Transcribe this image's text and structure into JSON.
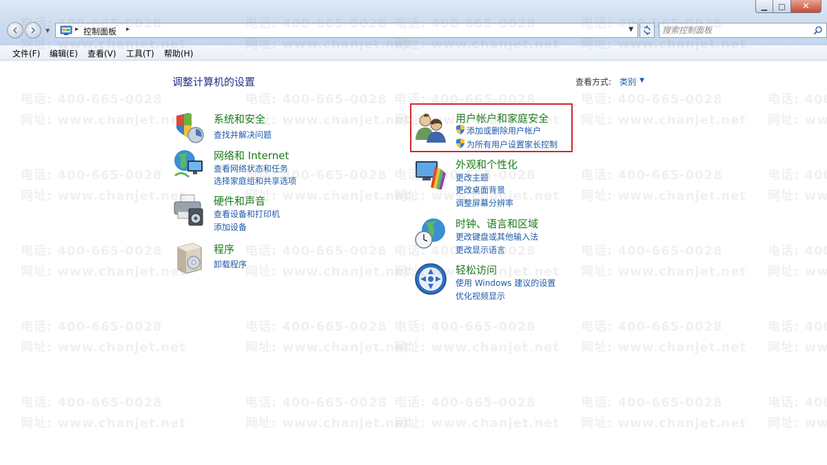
{
  "window": {
    "minimize": "▁",
    "maximize": "□",
    "close": "✕"
  },
  "address": {
    "path": "控制面板"
  },
  "search": {
    "placeholder": "搜索控制面板"
  },
  "menu": {
    "file": "文件(F)",
    "edit": "编辑(E)",
    "view": "查看(V)",
    "tools": "工具(T)",
    "help": "帮助(H)"
  },
  "main": {
    "title": "调整计算机的设置",
    "view_by_label": "查看方式:",
    "view_by_value": "类别"
  },
  "categories": {
    "system": {
      "title": "系统和安全",
      "links": [
        "查找并解决问题"
      ]
    },
    "network": {
      "title": "网络和 Internet",
      "links": [
        "查看网络状态和任务",
        "选择家庭组和共享选项"
      ]
    },
    "hardware": {
      "title": "硬件和声音",
      "links": [
        "查看设备和打印机",
        "添加设备"
      ]
    },
    "programs": {
      "title": "程序",
      "links": [
        "卸载程序"
      ]
    },
    "users": {
      "title": "用户帐户和家庭安全",
      "links": [
        "添加或删除用户帐户",
        "为所有用户设置家长控制"
      ]
    },
    "appearance": {
      "title": "外观和个性化",
      "links": [
        "更改主题",
        "更改桌面背景",
        "调整屏幕分辨率"
      ]
    },
    "clock": {
      "title": "时钟、语言和区域",
      "links": [
        "更改键盘或其他输入法",
        "更改显示语言"
      ]
    },
    "ease": {
      "title": "轻松访问",
      "links": [
        "使用 Windows 建议的设置",
        "优化视频显示"
      ]
    }
  },
  "watermark": {
    "phone": "电话: 400-665-0028",
    "site": "网址: www.chanjet.net"
  },
  "colors": {
    "category_title": "#1a7a1a",
    "link": "#1e5aa8",
    "page_title": "#1e3287",
    "highlight_border": "#d0262b"
  }
}
